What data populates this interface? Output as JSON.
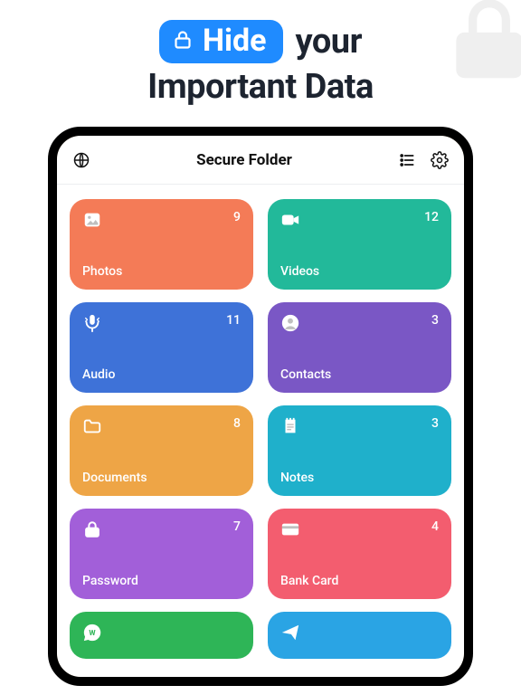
{
  "hero": {
    "pill_label": "Hide",
    "line1_rest": "your",
    "line2": "Important Data"
  },
  "topbar": {
    "title": "Secure Folder"
  },
  "cards": [
    {
      "label": "Photos",
      "count": "9",
      "color": "#f47b57",
      "icon": "photo"
    },
    {
      "label": "Videos",
      "count": "12",
      "color": "#22b99a",
      "icon": "video"
    },
    {
      "label": "Audio",
      "count": "11",
      "color": "#3e72d8",
      "icon": "mic"
    },
    {
      "label": "Contacts",
      "count": "3",
      "color": "#7a57c5",
      "icon": "contact"
    },
    {
      "label": "Documents",
      "count": "8",
      "color": "#eea546",
      "icon": "folder"
    },
    {
      "label": "Notes",
      "count": "3",
      "color": "#1fb0cb",
      "icon": "note"
    },
    {
      "label": "Password",
      "count": "7",
      "color": "#a25fd9",
      "icon": "lock"
    },
    {
      "label": "Bank Card",
      "count": "4",
      "color": "#f35d6f",
      "icon": "card"
    },
    {
      "label": "",
      "count": "",
      "color": "#2eb557",
      "icon": "whatsapp"
    },
    {
      "label": "",
      "count": "",
      "color": "#2aa4e4",
      "icon": "send"
    }
  ]
}
